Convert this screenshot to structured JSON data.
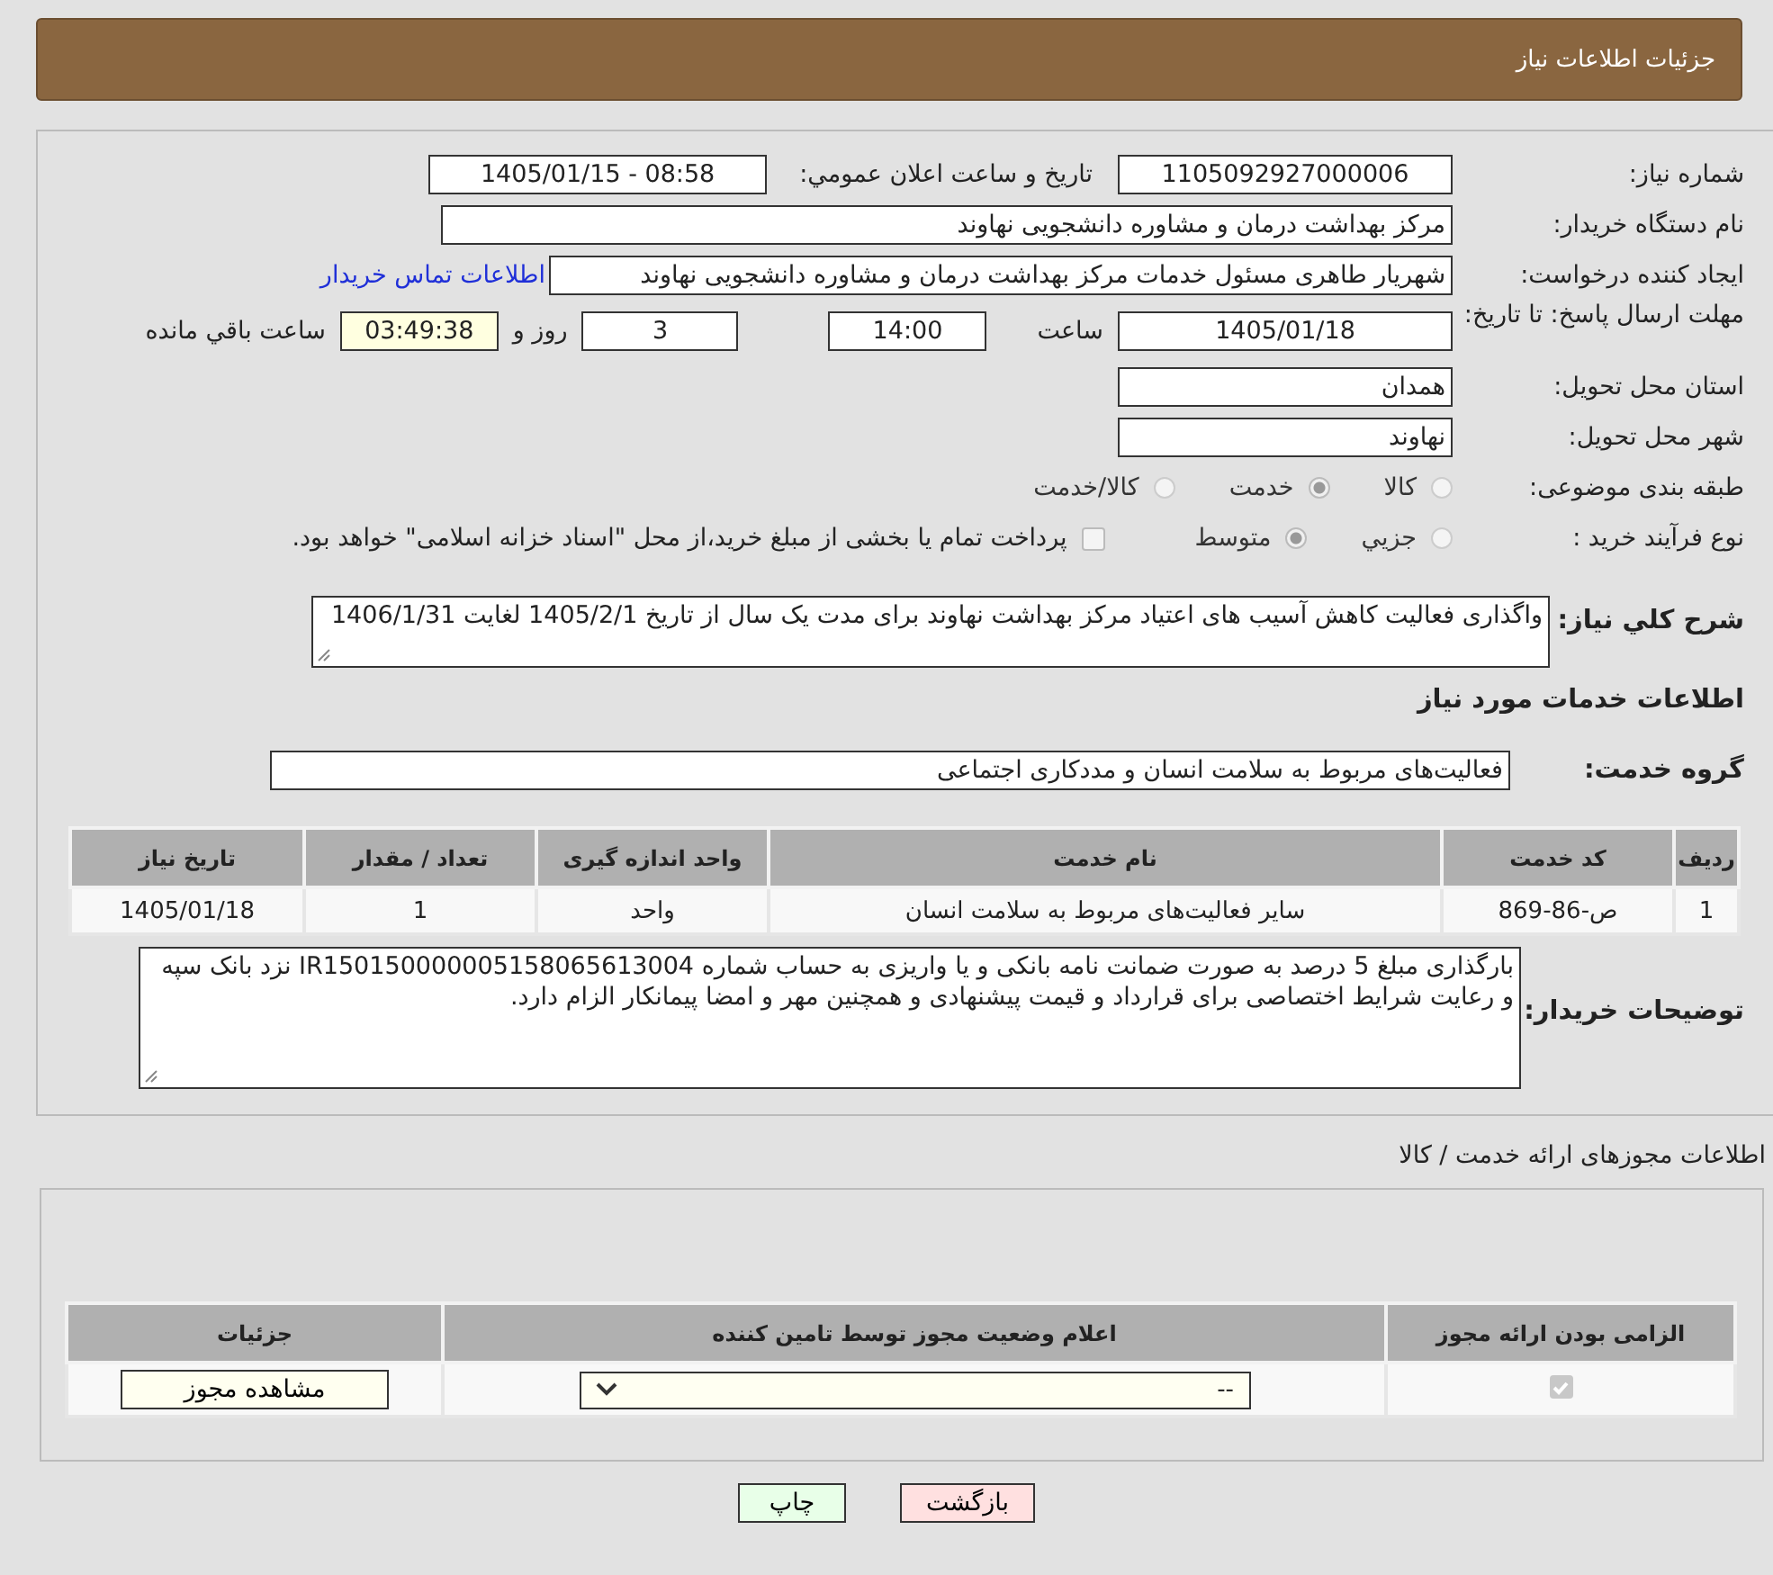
{
  "header": {
    "title": "جزئیات اطلاعات نیاز"
  },
  "need_number": {
    "label": "شماره نیاز:",
    "value": "1105092927000006"
  },
  "announce": {
    "label": "تاریخ و ساعت اعلان عمومي:",
    "value": "1405/01/15 - 08:58"
  },
  "buyer_org": {
    "label": "نام دستگاه خریدار:",
    "value": "مرکز بهداشت  درمان و مشاوره دانشجویی نهاوند"
  },
  "requester": {
    "label": "ایجاد کننده درخواست:",
    "value": "شهریار طاهری مسئول خدمات مرکز بهداشت  درمان و مشاوره دانشجویی نهاوند",
    "link": "اطلاعات تماس خریدار"
  },
  "deadline": {
    "label": "مهلت ارسال پاسخ: تا تاریخ:",
    "date": "1405/01/18",
    "time_label": "ساعت",
    "time": "14:00",
    "days": "3",
    "days_label": "روز و",
    "remaining": "03:49:38",
    "remaining_label": "ساعت باقي مانده"
  },
  "province": {
    "label": "استان محل تحویل:",
    "value": "همدان"
  },
  "city": {
    "label": "شهر محل تحویل:",
    "value": "نهاوند"
  },
  "category": {
    "label": "طبقه بندی موضوعی:",
    "options": [
      {
        "label": "کالا",
        "selected": false
      },
      {
        "label": "خدمت",
        "selected": true
      },
      {
        "label": "کالا/خدمت",
        "selected": false
      }
    ]
  },
  "process": {
    "label": "نوع فرآیند خرید :",
    "options": [
      {
        "label": "جزیي",
        "selected": false
      },
      {
        "label": "متوسط",
        "selected": true
      }
    ],
    "payment": {
      "checked": false,
      "label": "پرداخت تمام یا بخشی از مبلغ خرید،از محل \"اسناد خزانه اسلامی\" خواهد بود."
    }
  },
  "summary": {
    "label": "شرح كلي نياز:",
    "value": "واگذاری فعالیت کاهش آسیب های اعتیاد مرکز بهداشت نهاوند برای مدت یک سال از تاریخ 1405/2/1 لغایت 1406/1/31"
  },
  "services_title": "اطلاعات خدمات مورد نياز",
  "service_group": {
    "label": "گروه خدمت:",
    "value": "فعالیت‌های مربوط به سلامت انسان و مددکاری اجتماعی"
  },
  "services_table": {
    "columns": [
      "ردیف",
      "کد خدمت",
      "نام خدمت",
      "واحد اندازه گیری",
      "تعداد / مقدار",
      "تاریخ نیاز"
    ],
    "rows": [
      [
        "1",
        "ص-86-869",
        "سایر فعالیت‌های مربوط به سلامت انسان",
        "واحد",
        "1",
        "1405/01/18"
      ]
    ]
  },
  "buyer_notes": {
    "label": "توضیحات خریدار:",
    "value": "بارگذاری مبلغ 5 درصد به صورت ضمانت نامه بانکی و یا واریزی به حساب شماره IR150150000005158065613004  نزد بانک سپه و رعایت شرایط اختصاصی برای قرارداد و قیمت پیشنهادی و همچنین مهر و امضا پیمانکار الزام دارد."
  },
  "permits": {
    "title": "اطلاعات مجوزهای ارائه خدمت / کالا",
    "columns": [
      "الزامی بودن ارائه مجوز",
      "اعلام وضعیت مجوز توسط تامین کننده",
      "جزئیات"
    ],
    "rows": [
      {
        "required": true,
        "status": "--",
        "button": "مشاهده مجوز"
      }
    ]
  },
  "buttons": [
    {
      "kind": "back",
      "label": "بازگشت"
    },
    {
      "kind": "print",
      "label": "چاپ"
    }
  ]
}
